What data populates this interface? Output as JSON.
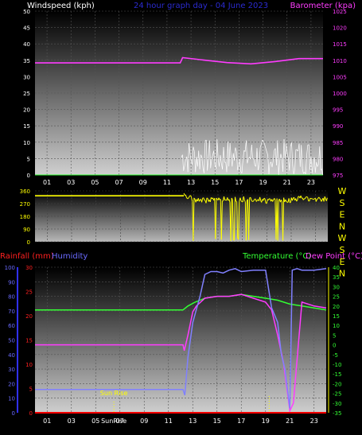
{
  "chart_data": [
    {
      "type": "line",
      "title": "24 hour graph day - 04 June 2023",
      "left_axis_label": "Windspeed (kph)",
      "right_axis_label": "Barometer (kpa)",
      "left_ticks": [
        "0",
        "5",
        "10",
        "15",
        "20",
        "25",
        "30",
        "35",
        "40",
        "45",
        "50"
      ],
      "right_ticks": [
        "975",
        "980",
        "985",
        "990",
        "995",
        "1000",
        "1005",
        "1010",
        "1015",
        "1020",
        "1025"
      ],
      "x_ticks": [
        "01",
        "03",
        "05",
        "07",
        "09",
        "11",
        "13",
        "15",
        "17",
        "19",
        "21",
        "23"
      ],
      "grid": true,
      "series": [
        {
          "name": "",
          "color": "#ff3cff",
          "axis": "right",
          "x": [
            0,
            6,
            12.1,
            12.3,
            14,
            16,
            18,
            20,
            22,
            24
          ],
          "y": [
            1009.2,
            1009.2,
            1009.2,
            1010.8,
            1010.1,
            1009.3,
            1008.9,
            1009.6,
            1010.5,
            1010.5
          ]
        },
        {
          "name": "",
          "color": "#ffffff",
          "axis": "left",
          "x": [
            12.2,
            24
          ],
          "y_range": [
            0,
            11
          ]
        }
      ]
    },
    {
      "type": "scatter",
      "title": "",
      "left_ticks": [
        "0",
        "90",
        "180",
        "270",
        "360"
      ],
      "right_labels": [
        "W",
        "S",
        "E",
        "N",
        "W",
        "S",
        "E",
        "N"
      ],
      "grid": true,
      "series": [
        {
          "name": "",
          "color": "#ffff00",
          "x": [
            0,
            12.2,
            13,
            14,
            15,
            16,
            17,
            18,
            19,
            20,
            21,
            22,
            23,
            24
          ],
          "y": [
            325,
            325,
            300,
            290,
            310,
            295,
            300,
            305,
            290,
            300,
            295,
            310,
            300,
            305
          ]
        }
      ]
    },
    {
      "type": "line",
      "title": "",
      "rain_label": "Rainfall (mm)",
      "humidity_label": "Humidity",
      "temp_label": "Temperature (°C)",
      "dew_label": "Dew Point (°C)",
      "rain_ticks": [
        "0",
        "5",
        "10",
        "15",
        "20",
        "25",
        "30"
      ],
      "humidity_ticks": [
        "0",
        "10",
        "20",
        "30",
        "40",
        "50",
        "60",
        "70",
        "80",
        "90",
        "100"
      ],
      "temp_ticks": [
        "-35",
        "-30",
        "-25",
        "-20",
        "-15",
        "-10",
        "-5",
        "0",
        "5",
        "10",
        "15",
        "20",
        "25",
        "30",
        "35",
        "40"
      ],
      "x_ticks": [
        "01",
        "03",
        "05",
        "07",
        "09",
        "11",
        "13",
        "15",
        "17",
        "19",
        "21",
        "23"
      ],
      "sunrise_labels": [
        "Sun Rise",
        "SunRise"
      ],
      "grid": true,
      "series": [
        {
          "name": "Temperature (°C)",
          "color": "#33ff33",
          "x": [
            0,
            12.2,
            12.6,
            13.2,
            14,
            15,
            16,
            17,
            18,
            19,
            20,
            21,
            22,
            23,
            24
          ],
          "y": [
            18,
            18,
            20,
            22,
            24,
            25,
            25,
            26,
            25,
            24,
            23,
            21,
            20,
            19,
            18
          ]
        },
        {
          "name": "Dew Point (°C)",
          "color": "#ff3cff",
          "x": [
            0,
            12.2,
            12.3,
            12.6,
            13,
            13.3,
            14,
            15,
            16,
            17,
            18,
            19,
            19.5,
            20,
            20.5,
            21,
            21.3,
            22,
            23,
            24
          ],
          "y": [
            0,
            0,
            -3,
            5,
            17,
            20,
            24,
            25,
            25,
            26,
            24,
            22,
            18,
            5,
            -10,
            -34,
            -30,
            22,
            20,
            19
          ]
        },
        {
          "name": "Humidity",
          "color": "#8080ff",
          "x": [
            0,
            12.2,
            12.35,
            12.6,
            13,
            13.6,
            14,
            14.5,
            15,
            15.5,
            16,
            16.5,
            17,
            18,
            19,
            19.5,
            20,
            20.3,
            20.6,
            21,
            21.2,
            21.6,
            22,
            23,
            24
          ],
          "y": [
            16,
            16,
            12,
            38,
            62,
            80,
            95,
            97,
            97,
            96,
            98,
            99,
            97,
            98,
            98,
            72,
            62,
            40,
            30,
            3,
            98,
            99,
            98,
            98,
            99
          ]
        },
        {
          "name": "Rainfall (mm)",
          "color": "#ff0000",
          "x": [
            0,
            24
          ],
          "y": [
            0,
            0
          ]
        }
      ]
    }
  ]
}
